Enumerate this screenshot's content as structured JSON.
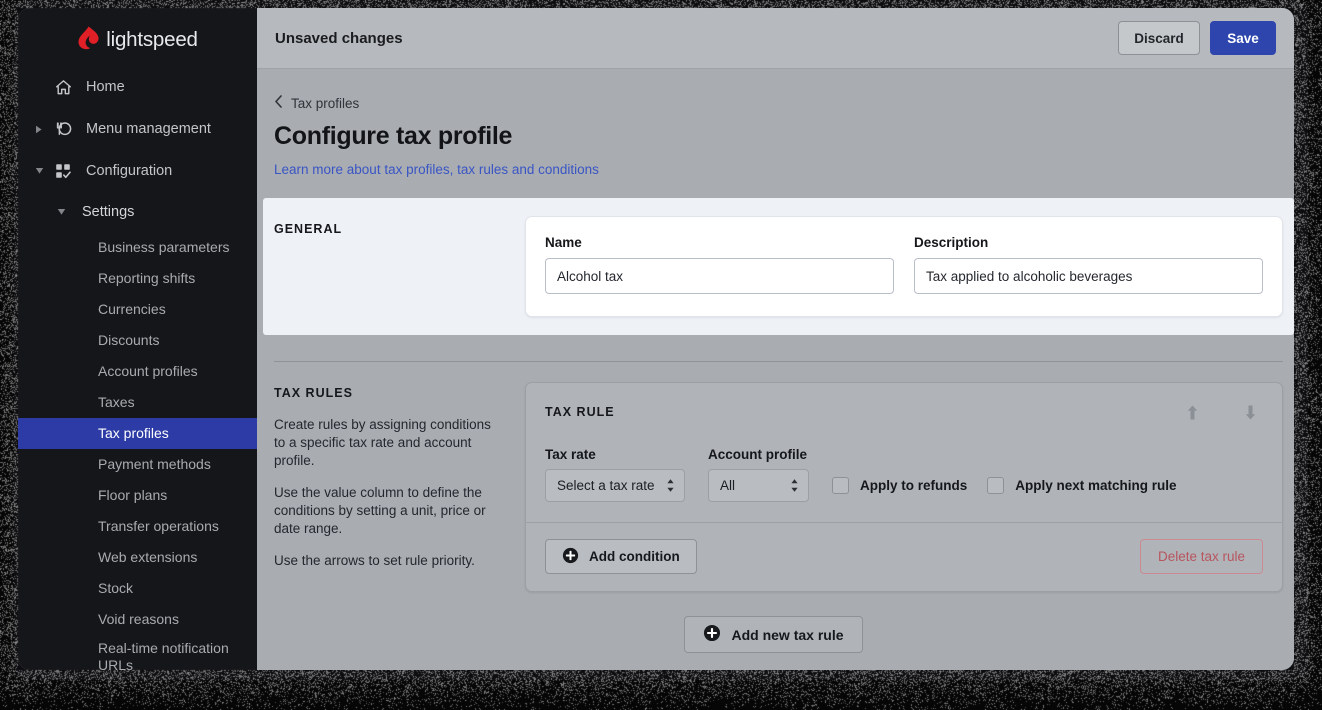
{
  "brand": {
    "name": "lightspeed",
    "flame_color": "#e01f26",
    "accent_blue": "#2e45ad",
    "active_nav_blue": "#2c3ba5",
    "link_blue": "#3a55c4",
    "danger_red": "#b8555f"
  },
  "sidebar": {
    "nav": [
      {
        "label": "Home",
        "icon": "home-icon",
        "caret": "",
        "active": false
      },
      {
        "label": "Menu management",
        "icon": "menu-management-icon",
        "caret": "collapsed",
        "active": false
      },
      {
        "label": "Configuration",
        "icon": "configuration-icon",
        "caret": "expanded",
        "active": false
      }
    ],
    "settings": {
      "label": "Settings",
      "caret": "expanded"
    },
    "items": [
      {
        "label": "Business parameters",
        "active": false
      },
      {
        "label": "Reporting shifts",
        "active": false
      },
      {
        "label": "Currencies",
        "active": false
      },
      {
        "label": "Discounts",
        "active": false
      },
      {
        "label": "Account profiles",
        "active": false
      },
      {
        "label": "Taxes",
        "active": false
      },
      {
        "label": "Tax profiles",
        "active": true
      },
      {
        "label": "Payment methods",
        "active": false
      },
      {
        "label": "Floor plans",
        "active": false
      },
      {
        "label": "Transfer operations",
        "active": false
      },
      {
        "label": "Web extensions",
        "active": false
      },
      {
        "label": "Stock",
        "active": false
      },
      {
        "label": "Void reasons",
        "active": false
      },
      {
        "label": "Real-time notification URLs",
        "active": false
      }
    ]
  },
  "topbar": {
    "status": "Unsaved changes",
    "discard_label": "Discard",
    "save_label": "Save"
  },
  "page": {
    "breadcrumb": "Tax profiles",
    "title": "Configure tax profile",
    "learn_more": "Learn more about tax profiles, tax rules and conditions"
  },
  "general": {
    "heading": "GENERAL",
    "name": {
      "label": "Name",
      "value": "Alcohol tax",
      "placeholder": ""
    },
    "description": {
      "label": "Description",
      "value": "Tax applied to alcoholic beverages",
      "placeholder": ""
    }
  },
  "tax_rules": {
    "heading": "TAX RULES",
    "paragraphs": [
      "Create rules by assigning conditions to a specific tax rate and account profile.",
      "Use the value column to define the conditions by setting a unit, price or date range.",
      "Use the arrows to set rule priority."
    ],
    "rule": {
      "heading": "TAX RULE",
      "move_up_title": "Move rule up",
      "move_down_title": "Move rule down",
      "tax_rate": {
        "label": "Tax rate",
        "value": "Select a tax rate"
      },
      "account_profile": {
        "label": "Account profile",
        "value": "All"
      },
      "apply_to_refunds": {
        "label": "Apply to refunds",
        "checked": false
      },
      "apply_next_matching_rule": {
        "label": "Apply next matching rule",
        "checked": false
      },
      "add_condition_label": "Add condition",
      "delete_label": "Delete tax rule"
    },
    "add_new_rule_label": "Add new tax rule"
  }
}
